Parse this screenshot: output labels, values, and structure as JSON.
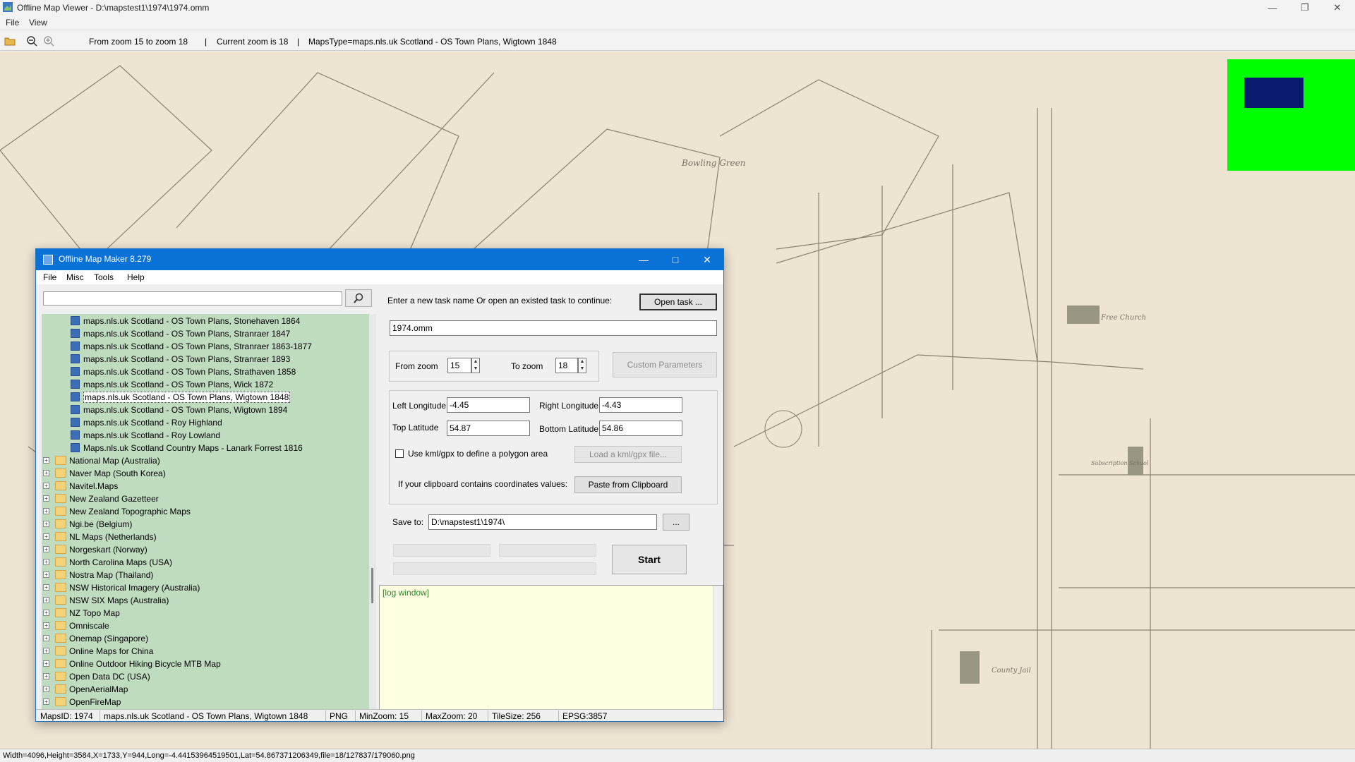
{
  "window": {
    "title": "Offline Map Viewer - D:\\mapstest1\\1974\\1974.omm"
  },
  "menu": {
    "file": "File",
    "view": "View"
  },
  "toolbar": {
    "zoom_range": "From zoom 15 to zoom 18",
    "sep1": "|",
    "current_zoom": "Current zoom is 18",
    "sep2": "|",
    "maps_type": "MapsType=maps.nls.uk Scotland - OS Town Plans, Wigtown 1848"
  },
  "status": {
    "text": "Width=4096,Height=3584,X=1733,Y=944,Long=-4.44153964519501,Lat=54.867371206349,file=18/127837/179060.png"
  },
  "colors": {
    "overview_bg": "#00ff00",
    "overview_viewport": "#0a1a6e",
    "dialog_title": "#0a72d6",
    "tree_bg": "#c0dcc0",
    "log_bg": "#ffffe1"
  },
  "dialog": {
    "title": "Offline Map Maker 8.279",
    "menu": {
      "file": "File",
      "misc": "Misc",
      "tools": "Tools",
      "help": "Help"
    },
    "search": {
      "value": "",
      "icon": "search-icon"
    },
    "tree": {
      "children": [
        {
          "label": "maps.nls.uk Scotland - OS Town Plans, Stonehaven 1864",
          "selected": false
        },
        {
          "label": "maps.nls.uk Scotland - OS Town Plans, Stranraer 1847",
          "selected": false
        },
        {
          "label": "maps.nls.uk Scotland - OS Town Plans, Stranraer 1863-1877",
          "selected": false
        },
        {
          "label": "maps.nls.uk Scotland - OS Town Plans, Stranraer 1893",
          "selected": false
        },
        {
          "label": "maps.nls.uk Scotland - OS Town Plans, Strathaven 1858",
          "selected": false
        },
        {
          "label": "maps.nls.uk Scotland - OS Town Plans, Wick 1872",
          "selected": false
        },
        {
          "label": "maps.nls.uk Scotland - OS Town Plans, Wigtown 1848",
          "selected": true
        },
        {
          "label": "maps.nls.uk Scotland - OS Town Plans, Wigtown 1894",
          "selected": false
        },
        {
          "label": "maps.nls.uk Scotland - Roy Highland",
          "selected": false
        },
        {
          "label": "maps.nls.uk Scotland - Roy Lowland",
          "selected": false
        },
        {
          "label": "Maps.nls.uk Scotland Country Maps - Lanark Forrest 1816",
          "selected": false
        }
      ],
      "folders": [
        "National Map (Australia)",
        "Naver Map (South Korea)",
        "Navitel.Maps",
        "New Zealand Gazetteer",
        "New Zealand Topographic Maps",
        "Ngi.be (Belgium)",
        "NL Maps (Netherlands)",
        "Norgeskart (Norway)",
        "North Carolina Maps (USA)",
        "Nostra Map (Thailand)",
        "NSW Historical Imagery (Australia)",
        "NSW SIX Maps (Australia)",
        "NZ Topo Map",
        "Omniscale",
        "Onemap (Singapore)",
        "Online Maps for China",
        "Online Outdoor Hiking Bicycle MTB Map",
        "Open Data DC (USA)",
        "OpenAerialMap",
        "OpenFireMap"
      ]
    },
    "task": {
      "prompt": "Enter a new task name Or open an existed task to continue:",
      "open_button": "Open task ...",
      "name_value": "1974.omm"
    },
    "zoom": {
      "from_label": "From zoom",
      "from_value": "15",
      "to_label": "To zoom",
      "to_value": "18",
      "custom_button": "Custom Parameters"
    },
    "coords": {
      "left_lon_label": "Left Longitude",
      "left_lon_value": "-4.45",
      "right_lon_label": "Right Longitude",
      "right_lon_value": "-4.43",
      "top_lat_label": "Top Latitude",
      "top_lat_value": "54.87",
      "bottom_lat_label": "Bottom Latitude",
      "bottom_lat_value": "54.86",
      "kml_checkbox_label": "Use kml/gpx to define a polygon area",
      "kml_checked": false,
      "load_kml_button": "Load a kml/gpx file...",
      "clipboard_label": "If your clipboard contains coordinates values:",
      "paste_button": "Paste from Clipboard"
    },
    "save": {
      "label": "Save to:",
      "value": "D:\\mapstest1\\1974\\",
      "browse_button": "..."
    },
    "start_button": "Start",
    "log": {
      "text": "[log window]"
    },
    "statusbar": {
      "maps_id": "MapsID: 1974",
      "map_name": "maps.nls.uk Scotland - OS Town Plans, Wigtown 1848",
      "format": "PNG",
      "min_zoom": "MinZoom: 15",
      "max_zoom": "MaxZoom: 20",
      "tile_size": "TileSize: 256",
      "epsg": "EPSG:3857"
    }
  }
}
